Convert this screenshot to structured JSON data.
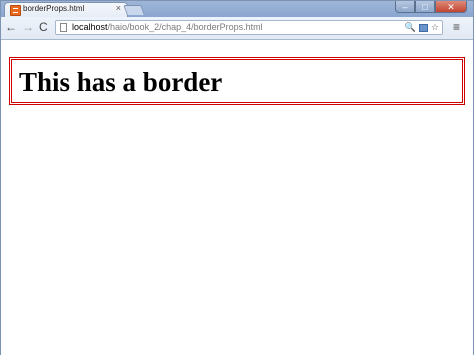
{
  "browser": {
    "tab": {
      "title": "borderProps.html",
      "close_glyph": "×"
    },
    "window_controls": {
      "minimize": "–",
      "maximize": "□",
      "close": "✕"
    },
    "nav": {
      "back": "←",
      "forward": "→",
      "reload": "C",
      "menu": "≡"
    },
    "address": {
      "host": "localhost",
      "path": "/haio/book_2/chap_4/borderProps.html"
    },
    "omnibox_icons": {
      "search": "🔍",
      "bookmark": "☆"
    }
  },
  "page": {
    "heading": "This has a border",
    "border_color": "#d00000",
    "border_style": "double"
  }
}
